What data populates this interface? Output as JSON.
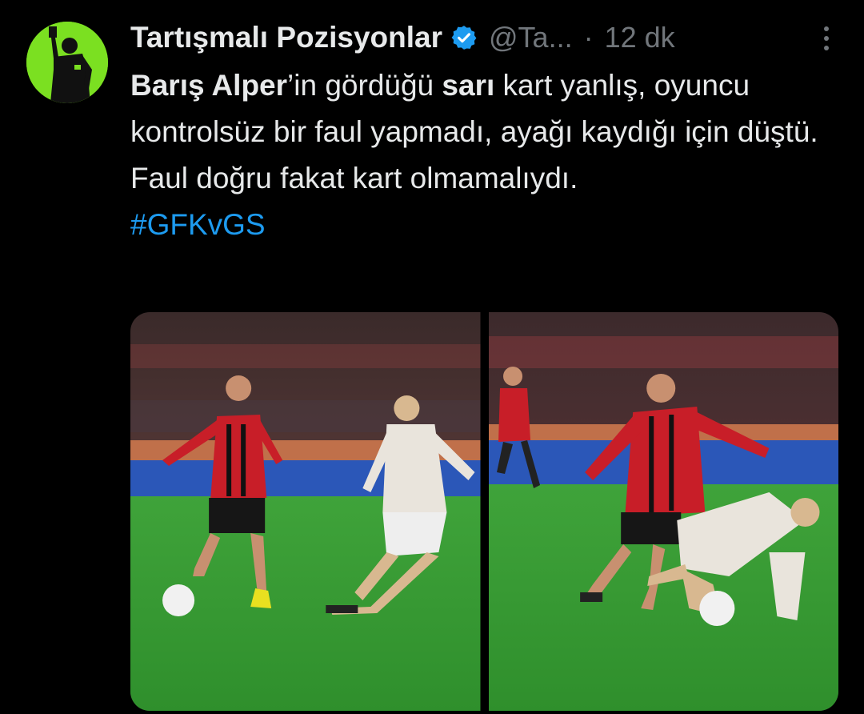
{
  "tweet": {
    "display_name": "Tartışmalı Pozisyonlar",
    "handle": "@Ta...",
    "separator": "·",
    "time": "12 dk",
    "text_bold_1": "Barış Alper",
    "text_part_1": "’in gördüğü ",
    "text_bold_2": "sarı",
    "text_part_2": " kart yanlış, oyuncu kontrolsüz bir faul yapmadı, ayağı kaydığı için düştü. Faul doğru fakat kart olmamalıydı.",
    "hashtag": "#GFKvGS",
    "icons": {
      "verified": "verified-badge-icon",
      "more": "more-options-icon"
    }
  },
  "colors": {
    "background": "#000000",
    "text": "#e7e9ea",
    "muted": "#71767b",
    "link": "#1d9bf0",
    "verified": "#1d9bf0",
    "avatar_bg": "#7be021"
  }
}
